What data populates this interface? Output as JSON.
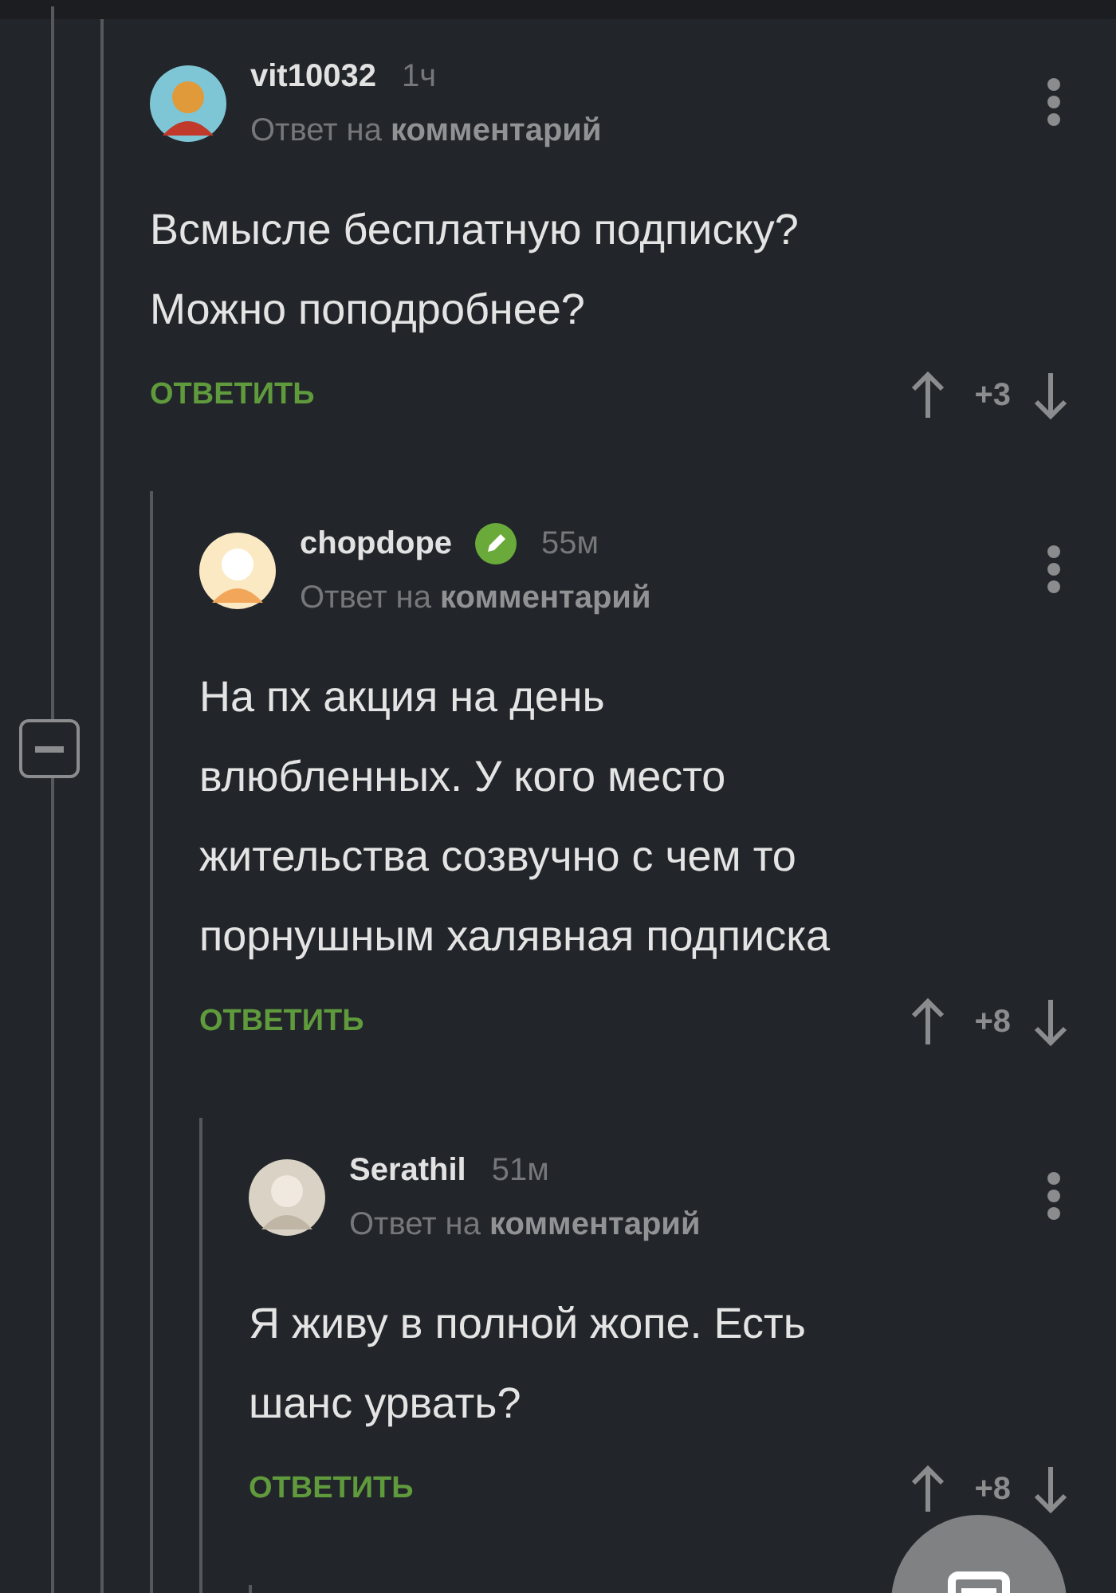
{
  "comments": [
    {
      "author": "vit10032",
      "badge": false,
      "time": "1ч",
      "reply_to": "Ответ на **комментарий**",
      "text": "Всмысле бесплатную подписку?\nМожно поподробнее?",
      "reply_label": "ОТВЕТИТЬ",
      "rating": "+3"
    },
    {
      "author": "chopdope",
      "badge": true,
      "time": "55м",
      "reply_to": "Ответ на **комментарий**",
      "text": "На пх акция на день\nвлюбленных. У кого место\nжительства созвучно с чем то\nпорнушным халявная подписка",
      "reply_label": "ОТВЕТИТЬ",
      "rating": "+8"
    },
    {
      "author": "Serathil",
      "badge": false,
      "time": "51м",
      "reply_to": "Ответ на **комментарий**",
      "text": "Я живу в полной жопе. Есть\nшанс урвать?",
      "reply_label": "ОТВЕТИТЬ",
      "rating": "+8"
    }
  ]
}
